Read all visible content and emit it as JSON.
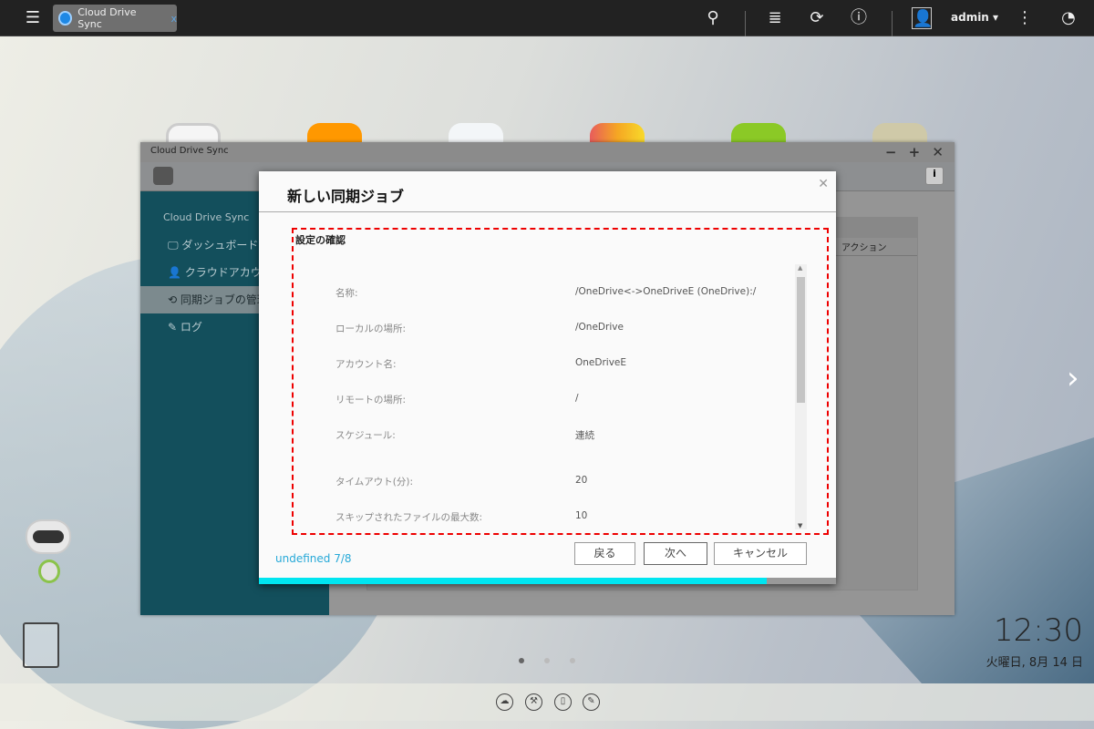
{
  "topbar": {
    "tab_label": "Cloud Drive Sync",
    "tab_close": "x",
    "user": "admin",
    "user_caret": "▾"
  },
  "window": {
    "title": "Cloud Drive Sync",
    "controls": "− + ✕",
    "table_header_action": "アクション",
    "sidebar": {
      "title": "Cloud Drive Sync",
      "items": [
        {
          "label": "ダッシュボード",
          "icon": "dashboard-icon"
        },
        {
          "label": "クラウドアカウント",
          "icon": "user-icon"
        },
        {
          "label": "同期ジョブの管理",
          "icon": "history-icon",
          "active": true
        },
        {
          "label": "ログ",
          "icon": "log-icon"
        }
      ]
    }
  },
  "dialog": {
    "title": "新しい同期ジョブ",
    "section_title": "設定の確認",
    "rows": [
      {
        "label": "名称:",
        "value": "/OneDrive<->OneDriveE (OneDrive):/"
      },
      {
        "label": "ローカルの場所:",
        "value": "/OneDrive"
      },
      {
        "label": "アカウント名:",
        "value": "OneDriveE"
      },
      {
        "label": "リモートの場所:",
        "value": "/"
      },
      {
        "label": "スケジュール:",
        "value": "連続"
      },
      {
        "label": "タイムアウト(分):",
        "value": "20"
      },
      {
        "label": "スキップされたファイルの最大数:",
        "value": "10"
      }
    ],
    "step": "undefined 7/8",
    "progress_percent": 88,
    "buttons": {
      "back": "戻る",
      "next": "次へ",
      "cancel": "キャンセル"
    }
  },
  "desktop": {
    "time": "12:30",
    "date": "火曜日, 8月 14 日",
    "page_dots": 3,
    "active_page": 1
  },
  "colors": {
    "accent": "#00e5f0",
    "sidebar": "#134f5c",
    "highlight": "#e00000"
  }
}
